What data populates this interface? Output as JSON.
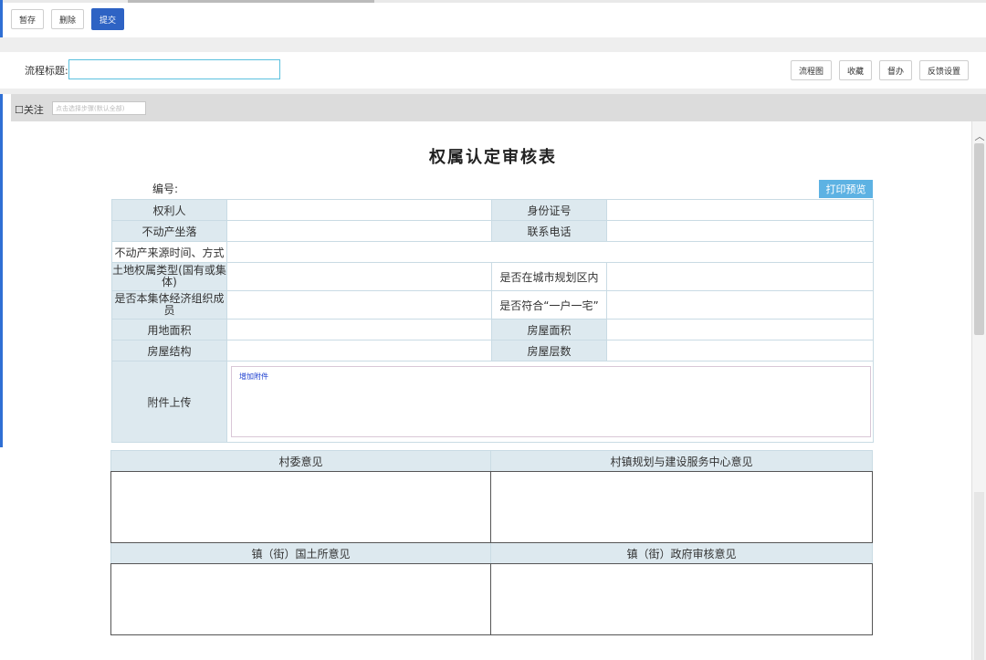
{
  "toolbar": {
    "save_draft": "暂存",
    "delete": "删除",
    "submit": "提交"
  },
  "title_row": {
    "label": "流程标题:",
    "input_value": "",
    "buttons": {
      "flowchart": "流程图",
      "favorite": "收藏",
      "supervise": "督办",
      "feedback": "反馈设置"
    }
  },
  "follow": {
    "checkbox_label": "☐关注",
    "step_placeholder": "点击选择步骤(默认全部)"
  },
  "scrollbar": {
    "up_arrow": "︿"
  },
  "form": {
    "title": "权属认定审核表",
    "serial_label": "编号:",
    "print_preview": "打印预览",
    "rows": {
      "right_holder": "权利人",
      "id_number": "身份证号",
      "location": "不动产坐落",
      "phone": "联系电话",
      "source": "不动产来源时间、方式",
      "land_type": "土地权属类型(国有或集体)",
      "in_planning": "是否在城市规划区内",
      "collective_member": "是否本集体经济组织成员",
      "one_household": "是否符合“一户一宅”",
      "land_area": "用地面积",
      "house_area": "房屋面积",
      "structure": "房屋结构",
      "floors": "房屋层数",
      "attachment": "附件上传",
      "add_attachment": "增加附件"
    }
  },
  "opinions": {
    "village_committee": "村委意见",
    "planning_center": "村镇规划与建设服务中心意见",
    "land_office": "镇（街）国土所意见",
    "government": "镇（街）政府审核意见"
  },
  "colors": {
    "primary": "#2e63c4",
    "print": "#5db2e3",
    "label_bg": "#dde9ef",
    "link": "#1d3fd0"
  }
}
